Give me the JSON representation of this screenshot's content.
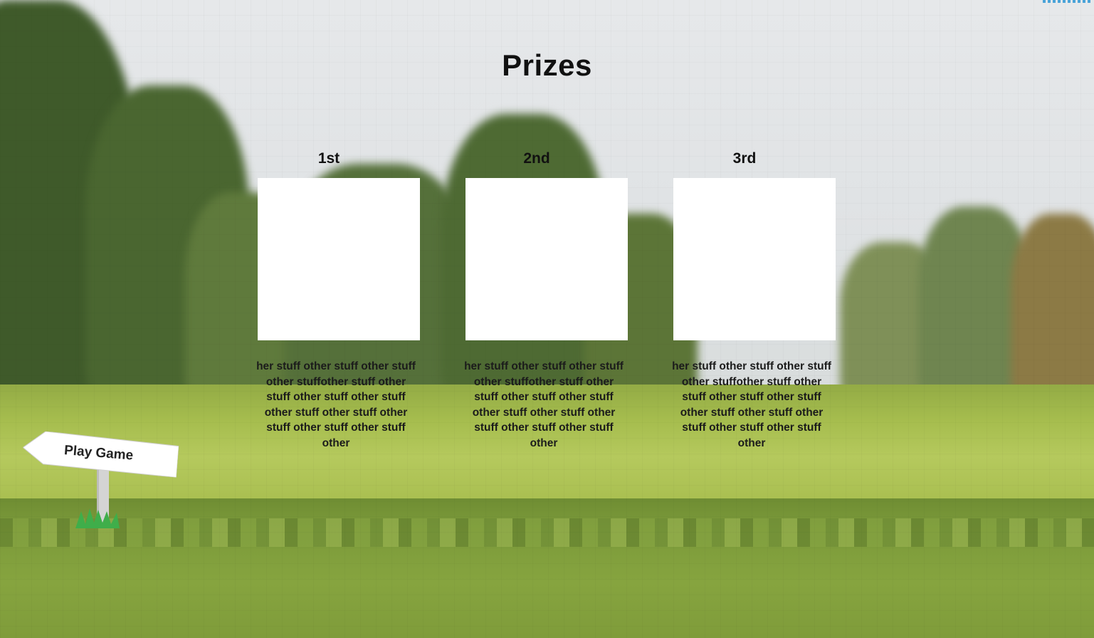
{
  "page": {
    "title": "Prizes"
  },
  "prizes": [
    {
      "rank": "1st",
      "description": "her stuff other stuff other stuff other stuffother stuff other stuff other stuff other stuff other stuff other stuff other stuff other stuff other stuff other"
    },
    {
      "rank": "2nd",
      "description": "her stuff other stuff other stuff other stuffother stuff other stuff other stuff other stuff other stuff other stuff other stuff other stuff other stuff other"
    },
    {
      "rank": "3rd",
      "description": "her stuff other stuff other stuff other stuffother stuff other stuff other stuff other stuff other stuff other stuff other stuff other stuff other stuff other"
    }
  ],
  "sign": {
    "label": "Play Game"
  },
  "colors": {
    "sky": "#e6e8ea",
    "grass": "#a6bd4e",
    "prize_box": "#ffffff",
    "text": "#111111"
  }
}
